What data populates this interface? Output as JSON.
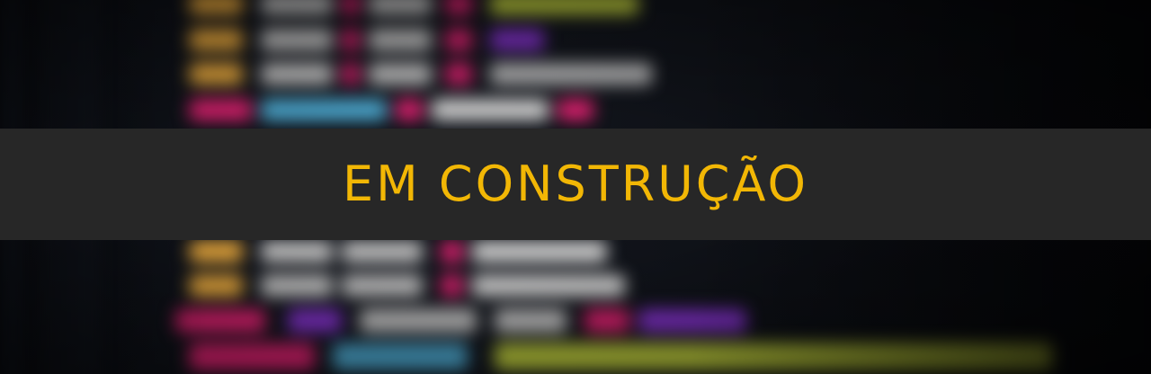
{
  "banner": {
    "title": "EM CONSTRUÇÃO",
    "text_color": "#f2b705",
    "background_color": "#272727"
  },
  "backdrop": {
    "description_colors": [
      "#e0a23a",
      "#d21f6a",
      "#b7c53a",
      "#7b2fbf",
      "#4aa3c9",
      "#c9c9c9"
    ]
  }
}
